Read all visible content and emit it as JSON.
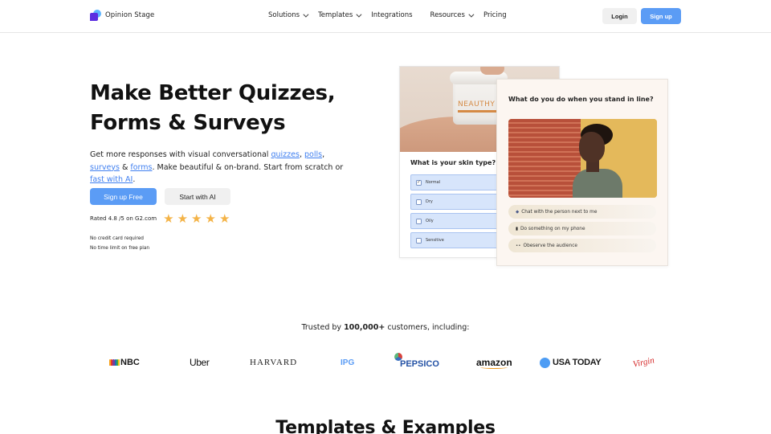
{
  "brand": {
    "name": "Opinion Stage",
    "primary_color": "#5b9cf5",
    "link_color": "#3f7ff0"
  },
  "nav": {
    "items": [
      {
        "label": "Solutions",
        "dropdown": true
      },
      {
        "label": "Templates",
        "dropdown": true
      },
      {
        "label": "Integrations",
        "dropdown": false
      },
      {
        "label": "Resources",
        "dropdown": true
      },
      {
        "label": "Pricing",
        "dropdown": false
      }
    ],
    "login_label": "Login",
    "signup_label": "Sign up"
  },
  "hero": {
    "title_line1": "Make Better Quizzes,",
    "title_line2": "Forms & Surveys",
    "sub_prefix": "Get more responses with visual conversational ",
    "link_quizzes": "quizzes",
    "comma1": ", ",
    "link_polls": "polls",
    "comma2": ", ",
    "link_surveys": "surveys",
    "amp": " & ",
    "link_forms": "forms",
    "sub_middle": ". Make beautiful & on-brand. Start from scratch or ",
    "link_ai": "fast with AI",
    "sub_end": ".",
    "primary_cta": "Sign up Free",
    "secondary_cta": "Start with AI",
    "rating_text": "Rated 4.8 /5 on G2.com",
    "rating_value": 4.8,
    "rating_max": 5,
    "star_glyph": "★",
    "note1": "No credit card required",
    "note2": "No time limit on free plan"
  },
  "preview_skin": {
    "brand_on_jar": "NEAUTHY",
    "question": "What is your skin type?",
    "options": [
      {
        "label": "Normal",
        "checked": true
      },
      {
        "label": "Dry",
        "checked": false
      },
      {
        "label": "Oily",
        "checked": false
      },
      {
        "label": "Sensitive",
        "checked": false
      }
    ],
    "check_glyph": "✓"
  },
  "preview_line": {
    "question": "What do you do when you stand in line?",
    "answers": [
      {
        "icon": "speech-bubble",
        "glyph": "◆",
        "label": "Chat with the person next to me"
      },
      {
        "icon": "phone",
        "glyph": "▮",
        "label": "Do something on my phone"
      },
      {
        "icon": "eyes",
        "glyph": "••",
        "label": "Obeserve the audience"
      }
    ]
  },
  "trusted": {
    "prefix": "Trusted by ",
    "count": "100,000+",
    "suffix": " customers, including:",
    "logos": [
      "NBC",
      "Uber",
      "HARVARD",
      "IPG",
      "PEPSICO",
      "amazon",
      "USA TODAY",
      "Virgin"
    ]
  },
  "next_section": {
    "title": "Templates & Examples"
  }
}
